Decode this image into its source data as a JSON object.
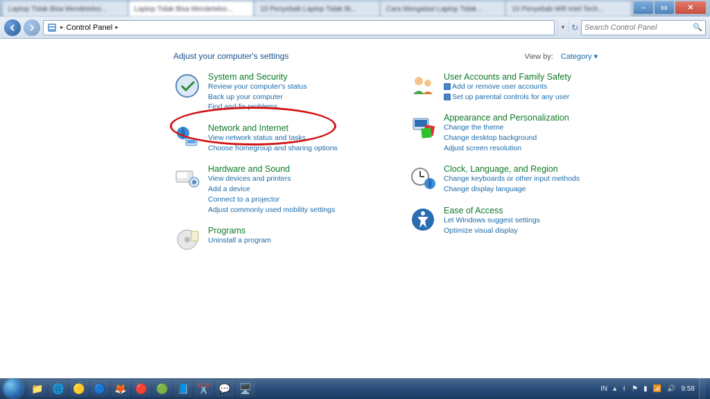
{
  "browser": {
    "tabs": [
      "Laptop Tidak Bisa Mendeteksi...",
      "Laptop Tidak Bisa Mendeteksi...",
      "10 Penyebab Laptop Tidak Bi...",
      "Cara Mengatasi Laptop Tidak...",
      "10 Penyebab Wifi Intel Tech..."
    ],
    "active_tab": 1
  },
  "addressbar": {
    "root": "Control Panel",
    "search_placeholder": "Search Control Panel"
  },
  "header": {
    "title": "Adjust your computer's settings",
    "viewby_label": "View by:",
    "viewby_value": "Category"
  },
  "left": [
    {
      "title": "System and Security",
      "links": [
        "Review your computer's status",
        "Back up your computer",
        "Find and fix problems"
      ]
    },
    {
      "title": "Network and Internet",
      "links": [
        "View network status and tasks",
        "Choose homegroup and sharing options"
      ]
    },
    {
      "title": "Hardware and Sound",
      "links": [
        "View devices and printers",
        "Add a device",
        "Connect to a projector",
        "Adjust commonly used mobility settings"
      ]
    },
    {
      "title": "Programs",
      "links": [
        "Uninstall a program"
      ]
    }
  ],
  "right": [
    {
      "title": "User Accounts and Family Safety",
      "shield_links": [
        "Add or remove user accounts",
        "Set up parental controls for any user"
      ]
    },
    {
      "title": "Appearance and Personalization",
      "links": [
        "Change the theme",
        "Change desktop background",
        "Adjust screen resolution"
      ]
    },
    {
      "title": "Clock, Language, and Region",
      "links": [
        "Change keyboards or other input methods",
        "Change display language"
      ]
    },
    {
      "title": "Ease of Access",
      "links": [
        "Let Windows suggest settings",
        "Optimize visual display"
      ]
    }
  ],
  "tray": {
    "lang": "IN",
    "time": "9:58"
  }
}
